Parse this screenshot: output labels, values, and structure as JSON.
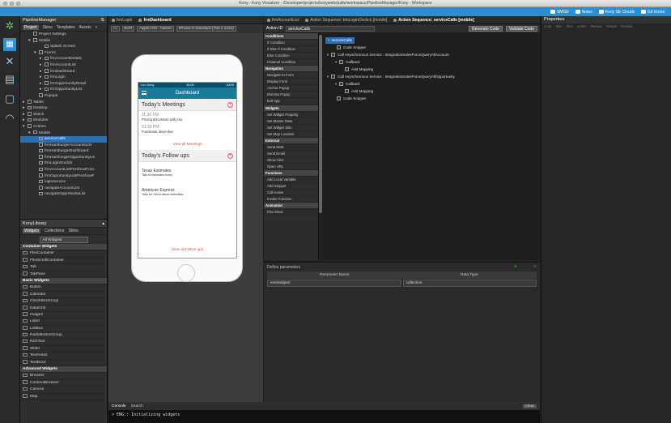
{
  "window": {
    "title": "Kony - Kony Visualizer - /Developer/projects/konywebstudio/workspace/PipelineManager/Kony - Workspace"
  },
  "topbar": {
    "items": [
      {
        "label": "SMGE"
      },
      {
        "label": "Notes"
      },
      {
        "label": "Kony SE Clouds"
      },
      {
        "label": "Ed Gross"
      }
    ]
  },
  "project": {
    "name": "PipelineManager",
    "tabs": [
      "Project",
      "Skins",
      "Templates",
      "Assets"
    ],
    "tree": [
      {
        "label": "Project Settings",
        "indent": 1
      },
      {
        "label": "Mobile",
        "indent": 1,
        "tw": "▾"
      },
      {
        "label": "Splash Screen",
        "indent": 3
      },
      {
        "label": "Forms",
        "indent": 2,
        "tw": "▾"
      },
      {
        "label": "frmAccountDetails",
        "indent": 3,
        "tw": "▸"
      },
      {
        "label": "frmAccountList",
        "indent": 3,
        "tw": "▸"
      },
      {
        "label": "frmDashboard",
        "indent": 3,
        "tw": "▸"
      },
      {
        "label": "frmLogin",
        "indent": 3,
        "tw": "▸"
      },
      {
        "label": "frmOpportunityDetail",
        "indent": 3,
        "tw": "▸"
      },
      {
        "label": "frmOpportunityList",
        "indent": 3,
        "tw": "▸"
      },
      {
        "label": "Popups",
        "indent": 2
      },
      {
        "label": "Tablet",
        "indent": 0,
        "tw": "▸"
      },
      {
        "label": "Desktop",
        "indent": 0,
        "tw": "▸"
      },
      {
        "label": "Watch",
        "indent": 0,
        "tw": "▸"
      },
      {
        "label": "Modules",
        "indent": 0,
        "tw": "▸"
      },
      {
        "label": "Actions",
        "indent": 0,
        "tw": "▾"
      },
      {
        "label": "Mobile",
        "indent": 1,
        "tw": "▾"
      },
      {
        "label": "serviceCalls",
        "indent": 2,
        "sel": true
      },
      {
        "label": "frmHamburgerAccountsList",
        "indent": 2
      },
      {
        "label": "frmHamburgerDashboard",
        "indent": 2
      },
      {
        "label": "frmHamburgerOpportunityLis",
        "indent": 2
      },
      {
        "label": "frmLoginOnclick",
        "indent": 2
      },
      {
        "label": "frmAccountListPreShowFunc",
        "indent": 2
      },
      {
        "label": "frmOpportunityListPreShowF",
        "indent": 2
      },
      {
        "label": "loginService",
        "indent": 2
      },
      {
        "label": "navigateAccountList",
        "indent": 2
      },
      {
        "label": "navigateOpportunityList",
        "indent": 2
      }
    ]
  },
  "library": {
    "title": "KonyLibrary",
    "tabs": [
      "Widgets",
      "Collections",
      "Skins"
    ],
    "filter": "All Widgets",
    "items": [
      {
        "label": "Container Widgets",
        "cat": true
      },
      {
        "label": "FlexContainer"
      },
      {
        "label": "FlexScrollContainer"
      },
      {
        "label": "Tab"
      },
      {
        "label": "TabPane"
      },
      {
        "label": "Basic Widgets",
        "cat": true
      },
      {
        "label": "Button"
      },
      {
        "label": "Calendar"
      },
      {
        "label": "CheckBoxGroup"
      },
      {
        "label": "DataGrid"
      },
      {
        "label": "Image2"
      },
      {
        "label": "Label"
      },
      {
        "label": "ListBox"
      },
      {
        "label": "RadioButtonGroup"
      },
      {
        "label": "RichText"
      },
      {
        "label": "Slider"
      },
      {
        "label": "TextArea2"
      },
      {
        "label": "TextBox2"
      },
      {
        "label": "Advanced Widgets",
        "cat": true
      },
      {
        "label": "Browser"
      },
      {
        "label": "CordovaBrowser"
      },
      {
        "label": "Camera"
      },
      {
        "label": "Map"
      }
    ]
  },
  "canvas": {
    "tabs": [
      "frmLogin",
      "frmDashboard"
    ],
    "toolbar": {
      "bp": "BVR",
      "platform": "Apple-iOS : Native",
      "device": "iPhone 6 Standard (750 x 1334)"
    },
    "phone": {
      "status_left": "••••• Kony",
      "status_time": "10:00",
      "status_right": "100%",
      "title": "Dashboard",
      "meetings_header": "Today's Meetings",
      "meetings": [
        {
          "time": "11:30 PM",
          "desc": "Pricing discussion with Asu"
        },
        {
          "time": "01:30 PM",
          "desc": "Functional deep-dive"
        }
      ],
      "meetings_link": "View all Meetings",
      "followups_header": "Today's Follow ups",
      "followups": [
        {
          "name": "Texas Estimates",
          "desc": "Talk to estimates team"
        },
        {
          "name": "American Express",
          "desc": "Task for Gmnt about estimates"
        }
      ],
      "followups_link": "View all Follow ups"
    }
  },
  "actions": {
    "tabs": [
      "frmAccountList",
      "Action Sequence: btnLoginOnclick [mobile]",
      "Action Sequence: serviceCalls [mobile]"
    ],
    "action_id_label": "Action ID",
    "action_id_value": "serviceCalls",
    "generate_btn": "Generate Code",
    "validate_btn": "Validate Code",
    "categories": [
      {
        "label": "Conditions",
        "h": true
      },
      {
        "label": "If Condition"
      },
      {
        "label": "If Else If Condition"
      },
      {
        "label": "Else Condition"
      },
      {
        "label": "Channel Condition"
      },
      {
        "label": "Navigation",
        "h": true
      },
      {
        "label": "Navigate to Form"
      },
      {
        "label": "Display Form"
      },
      {
        "label": "Anchor Popup"
      },
      {
        "label": "Dismiss Popup"
      },
      {
        "label": "Exit App"
      },
      {
        "label": "Widgets",
        "h": true
      },
      {
        "label": "Set Widget Property"
      },
      {
        "label": "Set Master Data"
      },
      {
        "label": "Set Widget Skin"
      },
      {
        "label": "Set Map Location"
      },
      {
        "label": "External",
        "h": true
      },
      {
        "label": "Send SMS"
      },
      {
        "label": "Send Email"
      },
      {
        "label": "Show Alert"
      },
      {
        "label": "Open URL"
      },
      {
        "label": "Functions",
        "h": true
      },
      {
        "label": "Add Local Variable"
      },
      {
        "label": "Add Snippet"
      },
      {
        "label": "Call Action"
      },
      {
        "label": "Invoke Function"
      },
      {
        "label": "Animation",
        "h": true
      },
      {
        "label": "Flex Move"
      }
    ],
    "flow": [
      {
        "label": "serviceCalls",
        "x": 4,
        "y": 5,
        "sel": true,
        "tw": "▾"
      },
      {
        "label": "Code Snippet",
        "x": 18,
        "y": 14,
        "cb": true
      },
      {
        "label": "Call Asynchronous Service : IntegrationSalesForceQueryAllAccount",
        "x": 6,
        "y": 23,
        "cb": true,
        "tw": "▾"
      },
      {
        "label": "Callback",
        "x": 16,
        "y": 32,
        "cb": true,
        "tw": "▾"
      },
      {
        "label": "Add Mapping",
        "x": 28,
        "y": 41,
        "cb": true
      },
      {
        "label": "Call Asynchronous Service : IntegrationSalesForceQueryAllOpportunity",
        "x": 6,
        "y": 50,
        "cb": true,
        "tw": "▾"
      },
      {
        "label": "Callback",
        "x": 16,
        "y": 59,
        "cb": true,
        "tw": "▾"
      },
      {
        "label": "Add Mapping",
        "x": 28,
        "y": 68,
        "cb": true
      },
      {
        "label": "Code Snippet",
        "x": 18,
        "y": 77,
        "cb": true
      }
    ],
    "params_title": "Define parameters",
    "param_headers": [
      "Parameter Name",
      "Data Type"
    ],
    "params": [
      {
        "name": "eventobject",
        "type": "collection"
      }
    ]
  },
  "console": {
    "tabs": [
      "Console",
      "Search"
    ],
    "clear": "Clear",
    "output": "> ENG:: Initializing widgets"
  },
  "properties": {
    "title": "Properties",
    "tabs": [
      "Look",
      "Skin",
      "Flex",
      "Action",
      "Review",
      "Widget",
      "Module"
    ]
  }
}
